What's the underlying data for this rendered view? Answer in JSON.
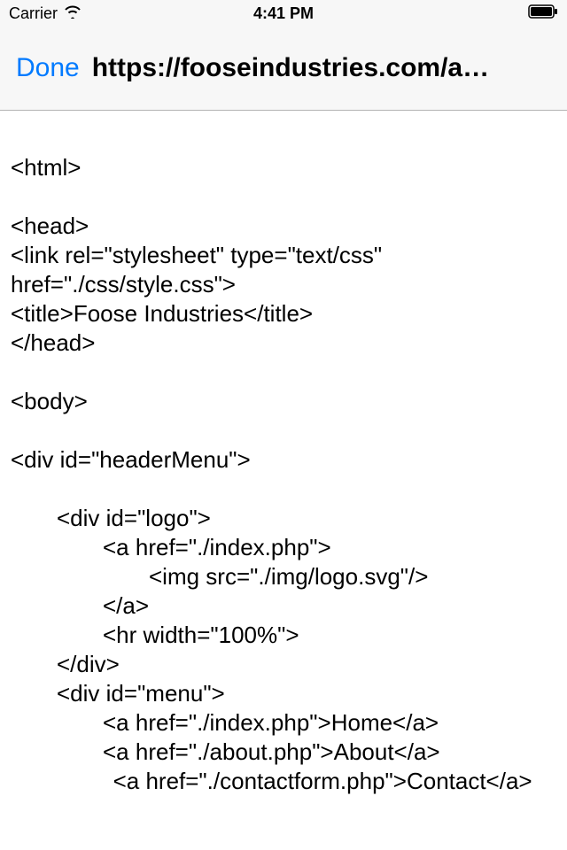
{
  "status": {
    "carrier": "Carrier",
    "time": "4:41 PM"
  },
  "nav": {
    "done": "Done",
    "url": "https://fooseindustries.com/a…"
  },
  "content": {
    "lines": [
      {
        "text": "<html>",
        "indent": 0
      },
      {
        "blank": true
      },
      {
        "text": "<head>",
        "indent": 0
      },
      {
        "text": "<link rel=\"stylesheet\" type=\"text/css\" href=\"./css/style.css\">",
        "indent": 0
      },
      {
        "text": "<title>Foose Industries</title>",
        "indent": 0
      },
      {
        "text": "</head>",
        "indent": 0
      },
      {
        "blank": true
      },
      {
        "text": "<body>",
        "indent": 0
      },
      {
        "blank": true
      },
      {
        "text": "<div id=\"headerMenu\">",
        "indent": 0
      },
      {
        "blank": true
      },
      {
        "text": "<div id=\"logo\">",
        "indent": 1
      },
      {
        "text": "<a href=\"./index.php\">",
        "indent": 2
      },
      {
        "text": "<img src=\"./img/logo.svg\"/>",
        "indent": 3
      },
      {
        "text": "</a>",
        "indent": 2
      },
      {
        "text": "<hr width=\"100%\">",
        "indent": 2
      },
      {
        "text": "</div>",
        "indent": 1
      },
      {
        "text": "<div id=\"menu\">",
        "indent": 1
      },
      {
        "text": "<a href=\"./index.php\">Home</a>",
        "indent": 2
      },
      {
        "text": "<a href=\"./about.php\">About</a>",
        "indent": 2
      },
      {
        "text": "<a href=\"./contactform.php\">Contact</a>",
        "indent": 2,
        "hang": true
      }
    ]
  }
}
